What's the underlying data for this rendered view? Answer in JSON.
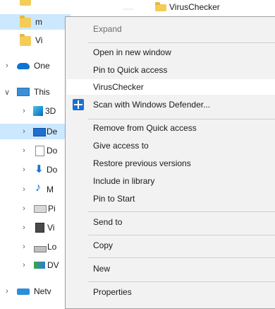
{
  "nav": {
    "items": [
      {
        "label": "",
        "icon": "folder-icon",
        "chevron": ""
      },
      {
        "label": "m",
        "icon": "folder-icon",
        "chevron": ""
      },
      {
        "label": "Vi",
        "icon": "folder-icon",
        "chevron": ""
      },
      {
        "label": "One",
        "icon": "onedrive-cloud-icon",
        "chevron": ">"
      },
      {
        "label": "This",
        "icon": "this-pc-icon",
        "chevron": "v"
      },
      {
        "label": "3D",
        "icon": "3d-objects-icon",
        "chevron": ">"
      },
      {
        "label": "De",
        "icon": "desktop-icon",
        "chevron": ">"
      },
      {
        "label": "Do",
        "icon": "documents-icon",
        "chevron": ">"
      },
      {
        "label": "Do",
        "icon": "downloads-icon",
        "chevron": ">"
      },
      {
        "label": "M",
        "icon": "music-icon",
        "chevron": ">"
      },
      {
        "label": "Pi",
        "icon": "pictures-icon",
        "chevron": ">"
      },
      {
        "label": "Vi",
        "icon": "videos-icon",
        "chevron": ">"
      },
      {
        "label": "Lo",
        "icon": "local-disk-icon",
        "chevron": ">"
      },
      {
        "label": "DV",
        "icon": "dvd-drive-icon",
        "chevron": ">"
      },
      {
        "label": "Netv",
        "icon": "network-icon",
        "chevron": ">"
      }
    ]
  },
  "background_right": {
    "label": "VirusChecker"
  },
  "context_menu": {
    "expand": "Expand",
    "open_new_window": "Open in new window",
    "pin_quick_access": "Pin to Quick access",
    "viruschecker": "VirusChecker",
    "scan_defender": "Scan with Windows Defender...",
    "remove_quick_access": "Remove from Quick access",
    "give_access": "Give access to",
    "restore_versions": "Restore previous versions",
    "include_library": "Include in library",
    "pin_start": "Pin to Start",
    "send_to": "Send to",
    "copy": "Copy",
    "new": "New",
    "properties": "Properties",
    "submenu_arrow": ">"
  },
  "colors": {
    "menu_bg": "#f2f2f2",
    "hover_bg": "#ffffff",
    "selected_nav_bg": "#cce8ff",
    "accent": "#1b6fd0"
  }
}
